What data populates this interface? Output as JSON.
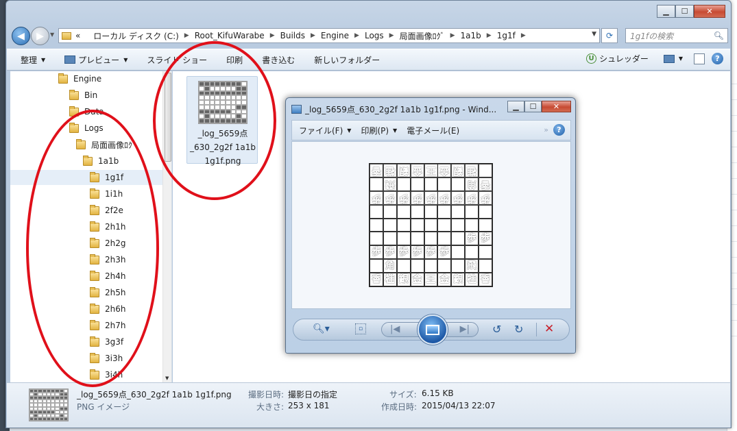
{
  "explorer": {
    "address": {
      "overflow": "«",
      "crumbs": [
        "ローカル ディスク (C:)",
        "Root_KifuWarabe",
        "Builds",
        "Engine",
        "Logs",
        "局面画像ﾛｸﾞ",
        "1a1b",
        "1g1f"
      ]
    },
    "search_placeholder": "1g1fの検索",
    "toolbar": {
      "organize": "整理",
      "preview": "プレビュー",
      "slideshow": "スライド ショー",
      "print": "印刷",
      "burn": "書き込む",
      "new_folder": "新しいフォルダー",
      "shredder": "シュレッダー"
    },
    "tree": [
      {
        "label": "Engine"
      },
      {
        "label": "Bin"
      },
      {
        "label": "Data"
      },
      {
        "label": "Logs"
      },
      {
        "label": "局面画像ﾛｸﾞ"
      },
      {
        "label": "1a1b"
      },
      {
        "label": "1g1f"
      },
      {
        "label": "1i1h"
      },
      {
        "label": "2f2e"
      },
      {
        "label": "2h1h"
      },
      {
        "label": "2h2g"
      },
      {
        "label": "2h3h"
      },
      {
        "label": "2h4h"
      },
      {
        "label": "2h5h"
      },
      {
        "label": "2h6h"
      },
      {
        "label": "2h7h"
      },
      {
        "label": "3g3f"
      },
      {
        "label": "3i3h"
      },
      {
        "label": "3i4h"
      }
    ],
    "file": {
      "name_line1": "_log_5659点",
      "name_line2": "_630_2g2f 1a1b",
      "name_line3": "1g1f.png"
    },
    "details": {
      "filename": "_log_5659点_630_2g2f 1a1b 1g1f.png",
      "filetype": "PNG イメージ",
      "taken_label": "撮影日時:",
      "taken_value": "撮影日の指定",
      "dims_label": "大きさ:",
      "dims_value": "253 x 181",
      "size_label": "サイズ:",
      "size_value": "6.15 KB",
      "created_label": "作成日時:",
      "created_value": "2015/04/13 22:07"
    }
  },
  "viewer": {
    "title": "_log_5659点_630_2g2f 1a1b 1g1f.png - Wind...",
    "menu": {
      "file": "ファイル(F)",
      "print": "印刷(P)",
      "email": "電子メール(E)"
    },
    "board": [
      [
        "香",
        "桂",
        "銀",
        "金",
        "王",
        "金",
        "銀",
        "桂",
        ""
      ],
      [
        "",
        "飛",
        "",
        "",
        "",
        "",
        "",
        "角",
        "香"
      ],
      [
        "歩",
        "歩",
        "歩",
        "歩",
        "歩",
        "歩",
        "歩",
        "歩",
        "歩"
      ],
      [
        "",
        "",
        "",
        "",
        "",
        "",
        "",
        "",
        ""
      ],
      [
        "",
        "",
        "",
        "",
        "",
        "",
        "",
        "",
        ""
      ],
      [
        "",
        "",
        "",
        "",
        "",
        "",
        "",
        "歩",
        "歩"
      ],
      [
        "歩",
        "歩",
        "歩",
        "歩",
        "歩",
        "歩",
        "",
        "",
        ""
      ],
      [
        "",
        "角",
        "",
        "",
        "",
        "",
        "",
        "飛",
        ""
      ],
      [
        "香",
        "桂",
        "銀",
        "金",
        "王",
        "金",
        "銀",
        "桂",
        "香"
      ]
    ],
    "board_reversed_rows": [
      0,
      1,
      2
    ]
  },
  "colors": {
    "annotation_red": "#e0101a",
    "accent_blue": "#2d6fb4"
  }
}
